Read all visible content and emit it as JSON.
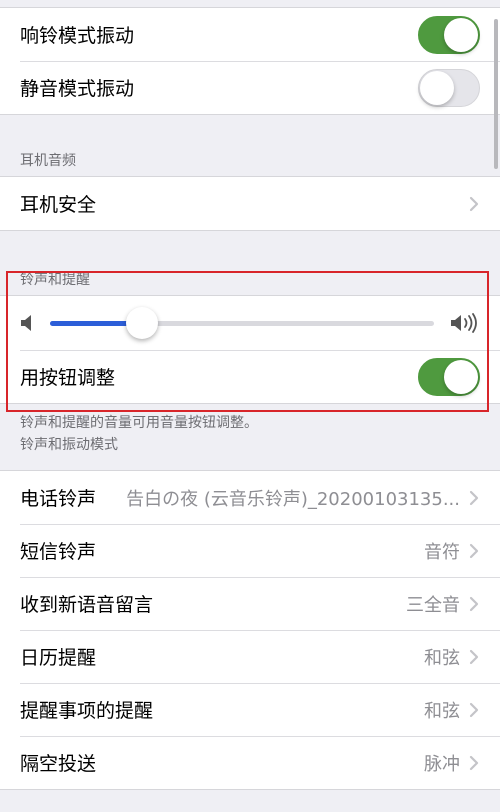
{
  "top_group": {
    "ring_vibrate_label": "响铃模式振动",
    "silent_vibrate_label": "静音模式振动"
  },
  "headphone_audio": {
    "section_title": "耳机音频",
    "safety_label": "耳机安全"
  },
  "ringer_alerts": {
    "section_title": "铃声和提醒",
    "volume_level": 0.24,
    "change_with_buttons_label": "用按钮调整",
    "footer_note": "铃声和提醒的音量可用音量按钮调整。"
  },
  "sounds_patterns": {
    "section_title": "铃声和振动模式",
    "rows": [
      {
        "label": "电话铃声",
        "value": "告白の夜 (云音乐铃声)_20200103135..."
      },
      {
        "label": "短信铃声",
        "value": "音符"
      },
      {
        "label": "收到新语音留言",
        "value": "三全音"
      },
      {
        "label": "日历提醒",
        "value": "和弦"
      },
      {
        "label": "提醒事项的提醒",
        "value": "和弦"
      },
      {
        "label": "隔空投送",
        "value": "脉冲"
      }
    ]
  },
  "switches": {
    "ring_vibrate_on": true,
    "silent_vibrate_on": false,
    "change_with_buttons_on": true
  },
  "colors": {
    "switch_on": "#4f9a3f",
    "slider_fill": "#2c5ed8",
    "highlight_border": "#d8252a"
  }
}
